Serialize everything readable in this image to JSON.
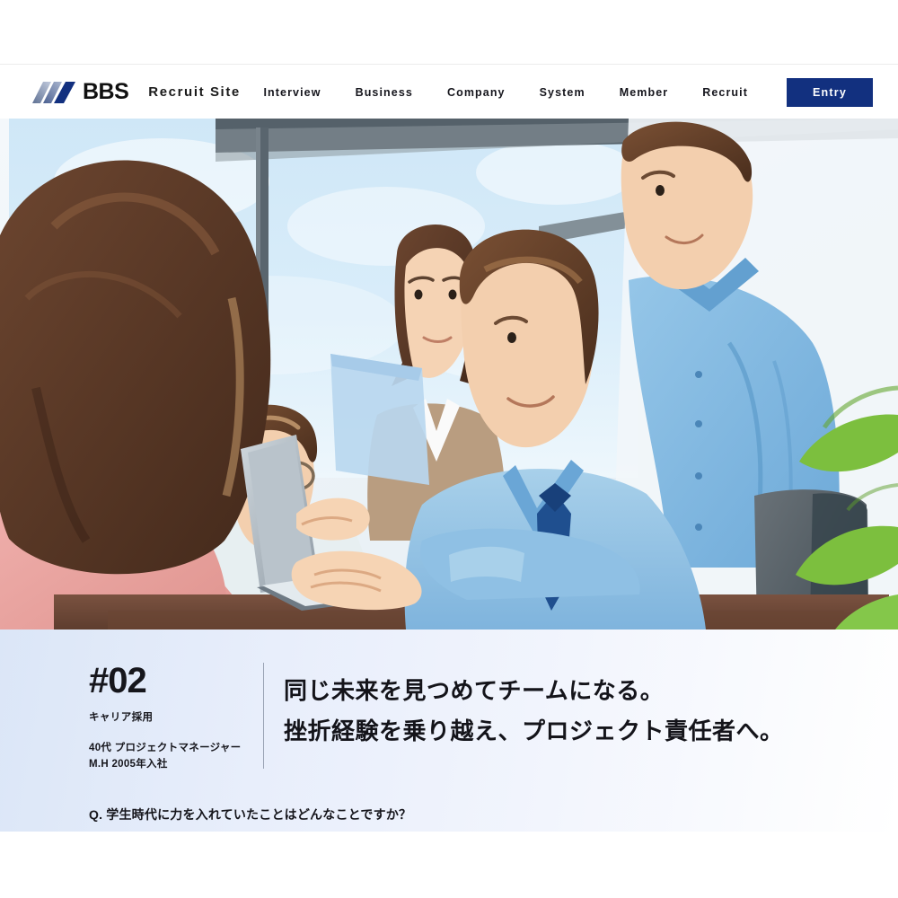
{
  "theme": {
    "accent_navy": "#12307f",
    "logo_blue": "#1b3f8f",
    "text_dark": "#15151b",
    "intro_bg_left": "#dbe6f7",
    "intro_bg_right": "#ffffff"
  },
  "header": {
    "logo_word": "BBS",
    "logo_icon": "bbs-slash-logo",
    "site_name": "Recruit Site",
    "nav": [
      {
        "label": "Interview"
      },
      {
        "label": "Business"
      },
      {
        "label": "Company"
      },
      {
        "label": "System"
      },
      {
        "label": "Member"
      },
      {
        "label": "Recruit"
      }
    ],
    "entry_label": "Entry"
  },
  "hero": {
    "alt": "office-meeting-illustration",
    "description": "Painted illustration of five office workers around a table with a laptop, window with blue sky behind, green plant leaves at right"
  },
  "intro": {
    "number": "#02",
    "category": "キャリア採用",
    "role_line1": "40代 プロジェクトマネージャー",
    "role_line2": "M.H 2005年入社",
    "headline_line1": "同じ未来を見つめてチームになる。",
    "headline_line2": "挫折経験を乗り越え、プロジェクト責任者へ。"
  },
  "body": {
    "question": "Q. 学生時代に力を入れていたことはどんなことですか？"
  }
}
